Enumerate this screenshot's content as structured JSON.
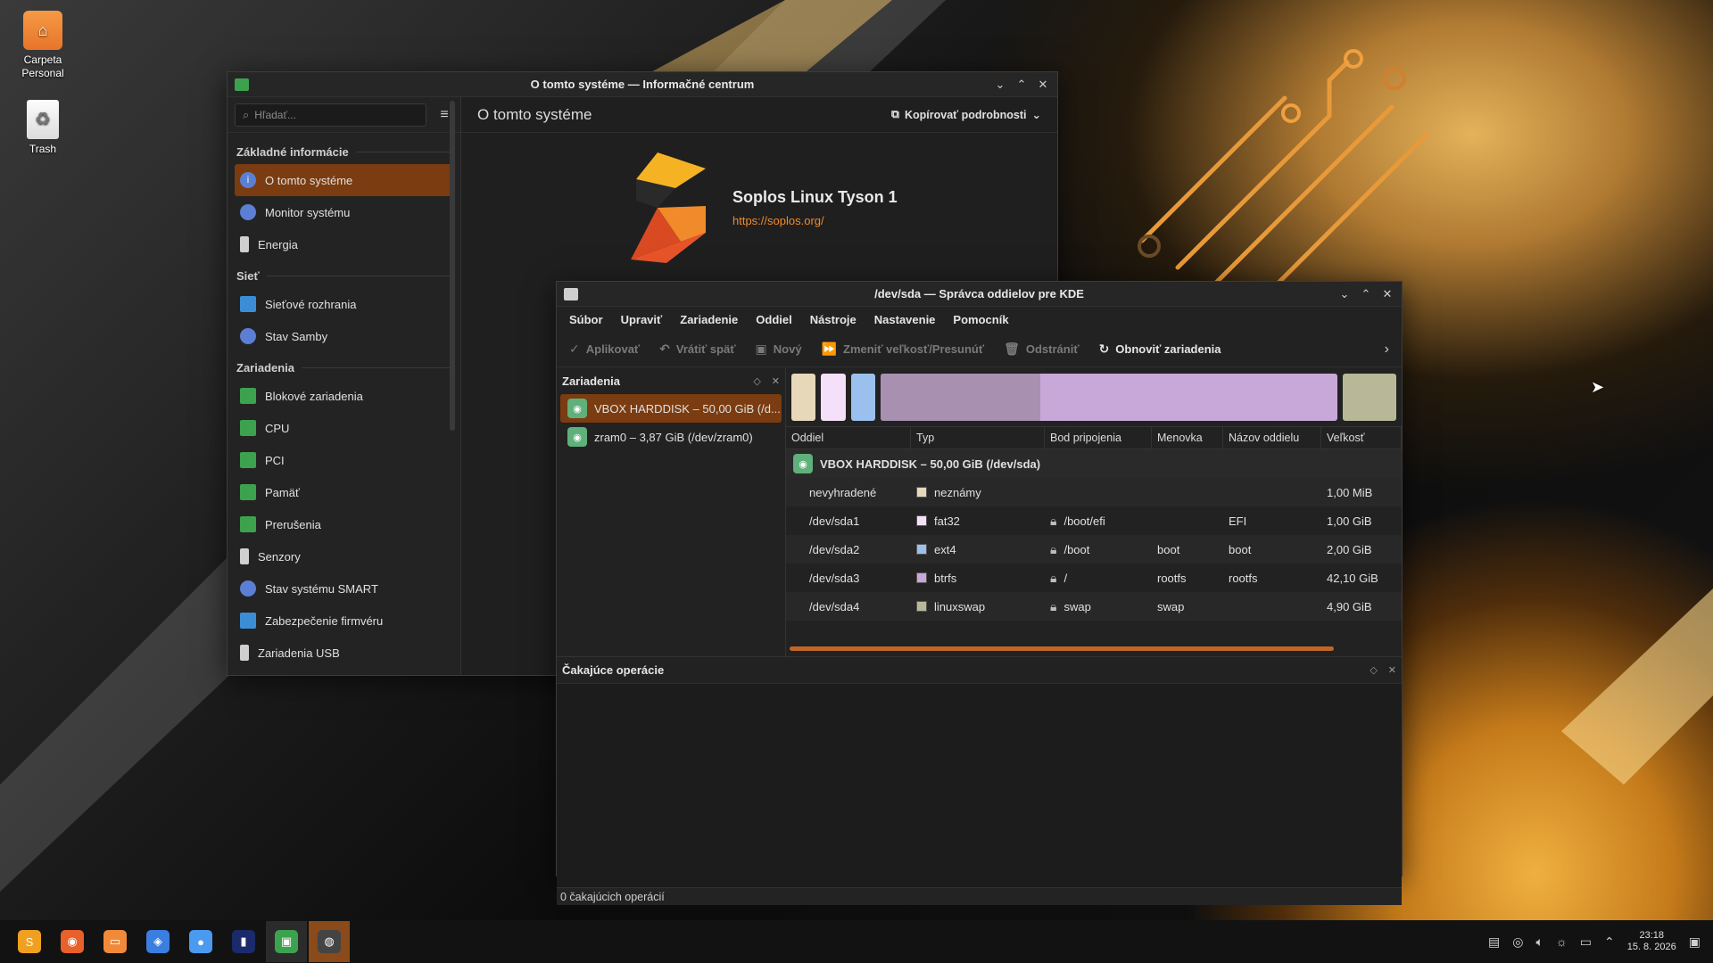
{
  "desktop": {
    "icons": [
      {
        "label": "Carpeta Personal",
        "icon": "home-folder-icon"
      },
      {
        "label": "Trash",
        "icon": "trash-icon"
      }
    ]
  },
  "info_center": {
    "title": "O tomto systéme — Informačné centrum",
    "search_placeholder": "Hľadať...",
    "page_heading": "O tomto systéme",
    "copy_button": "Kopírovať podrobnosti",
    "distro_name": "Soplos Linux Tyson 1",
    "distro_url": "https://soplos.org/",
    "sections": [
      {
        "title": "Základné informácie",
        "items": [
          {
            "label": "O tomto systéme",
            "icon": "info-icon",
            "active": true
          },
          {
            "label": "Monitor systému",
            "icon": "monitor-icon"
          },
          {
            "label": "Energia",
            "icon": "battery-icon"
          }
        ]
      },
      {
        "title": "Sieť",
        "items": [
          {
            "label": "Sieťové rozhrania",
            "icon": "network-icon"
          },
          {
            "label": "Stav Samby",
            "icon": "samba-icon"
          }
        ]
      },
      {
        "title": "Zariadenia",
        "items": [
          {
            "label": "Blokové zariadenia",
            "icon": "block-device-icon"
          },
          {
            "label": "CPU",
            "icon": "cpu-icon"
          },
          {
            "label": "PCI",
            "icon": "pci-icon"
          },
          {
            "label": "Pamäť",
            "icon": "memory-icon"
          },
          {
            "label": "Prerušenia",
            "icon": "interrupts-icon"
          },
          {
            "label": "Senzory",
            "icon": "thermometer-icon"
          },
          {
            "label": "Stav systému SMART",
            "icon": "smart-icon"
          },
          {
            "label": "Zabezpečenie firmvéru",
            "icon": "shield-icon"
          },
          {
            "label": "Zariadenia USB",
            "icon": "usb-icon"
          }
        ]
      }
    ]
  },
  "partition_manager": {
    "title": "/dev/sda — Správca oddielov pre KDE",
    "menu": [
      "Súbor",
      "Upraviť",
      "Zariadenie",
      "Oddiel",
      "Nástroje",
      "Nastavenie",
      "Pomocník"
    ],
    "toolbar": [
      {
        "label": "Aplikovať",
        "icon": "check-icon",
        "enabled": false
      },
      {
        "label": "Vrátiť späť",
        "icon": "undo-icon",
        "enabled": false
      },
      {
        "label": "Nový",
        "icon": "new-icon",
        "enabled": false
      },
      {
        "label": "Zmeniť veľkosť/Presunúť",
        "icon": "resize-icon",
        "enabled": false
      },
      {
        "label": "Odstrániť",
        "icon": "delete-icon",
        "enabled": false
      },
      {
        "label": "Obnoviť zariadenia",
        "icon": "refresh-icon",
        "enabled": true
      }
    ],
    "devices_panel_title": "Zariadenia",
    "devices": [
      {
        "label": "VBOX HARDDISK – 50,00 GiB (/d...",
        "active": true
      },
      {
        "label": "zram0 – 3,87 GiB (/dev/zram0)",
        "active": false
      }
    ],
    "columns": [
      "Oddiel",
      "Typ",
      "Bod pripojenia",
      "Menovka",
      "Názov oddielu",
      "Veľkosť"
    ],
    "disk_row": "VBOX HARDDISK – 50,00 GiB (/dev/sda)",
    "partitions": [
      {
        "name": "nevyhradené",
        "type": "neznámy",
        "color": "#e6d8b8",
        "locked": false,
        "mount": "",
        "label": "",
        "partname": "",
        "size": "1,00 MiB",
        "size_gib": 0.001
      },
      {
        "name": "/dev/sda1",
        "type": "fat32",
        "color": "#f4e0f8",
        "locked": true,
        "mount": "/boot/efi",
        "label": "",
        "partname": "EFI",
        "size": "1,00 GiB",
        "size_gib": 1.0
      },
      {
        "name": "/dev/sda2",
        "type": "ext4",
        "color": "#9cc0ee",
        "locked": true,
        "mount": "/boot",
        "label": "boot",
        "partname": "boot",
        "size": "2,00 GiB",
        "size_gib": 2.0
      },
      {
        "name": "/dev/sda3",
        "type": "btrfs",
        "color": "#c8a8d8",
        "locked": true,
        "mount": "/",
        "label": "rootfs",
        "partname": "rootfs",
        "size": "42,10 GiB",
        "size_gib": 42.1
      },
      {
        "name": "/dev/sda4",
        "type": "linuxswap",
        "color": "#b8b898",
        "locked": true,
        "mount": "swap",
        "label": "swap",
        "partname": "",
        "size": "4,90 GiB",
        "size_gib": 4.9
      }
    ],
    "btrfs_used_fraction": 0.35,
    "pending_title": "Čakajúce operácie",
    "status": "0 čakajúcich operácií"
  },
  "taskbar": {
    "apps": [
      {
        "name": "soplos-menu-icon",
        "color": "#f0a020"
      },
      {
        "name": "firefox-icon",
        "color": "#e8602a"
      },
      {
        "name": "file-manager-icon",
        "color": "#f08a3a"
      },
      {
        "name": "software-store-icon",
        "color": "#3a7ee0"
      },
      {
        "name": "toggle-icon",
        "color": "#4a9af0"
      },
      {
        "name": "terminal-icon",
        "color": "#1a2a6a"
      },
      {
        "name": "info-center-icon",
        "color": "#3da24e"
      },
      {
        "name": "partition-manager-icon",
        "color": "#444444"
      }
    ],
    "time": "23:18",
    "date": "15. 8. 2026"
  }
}
